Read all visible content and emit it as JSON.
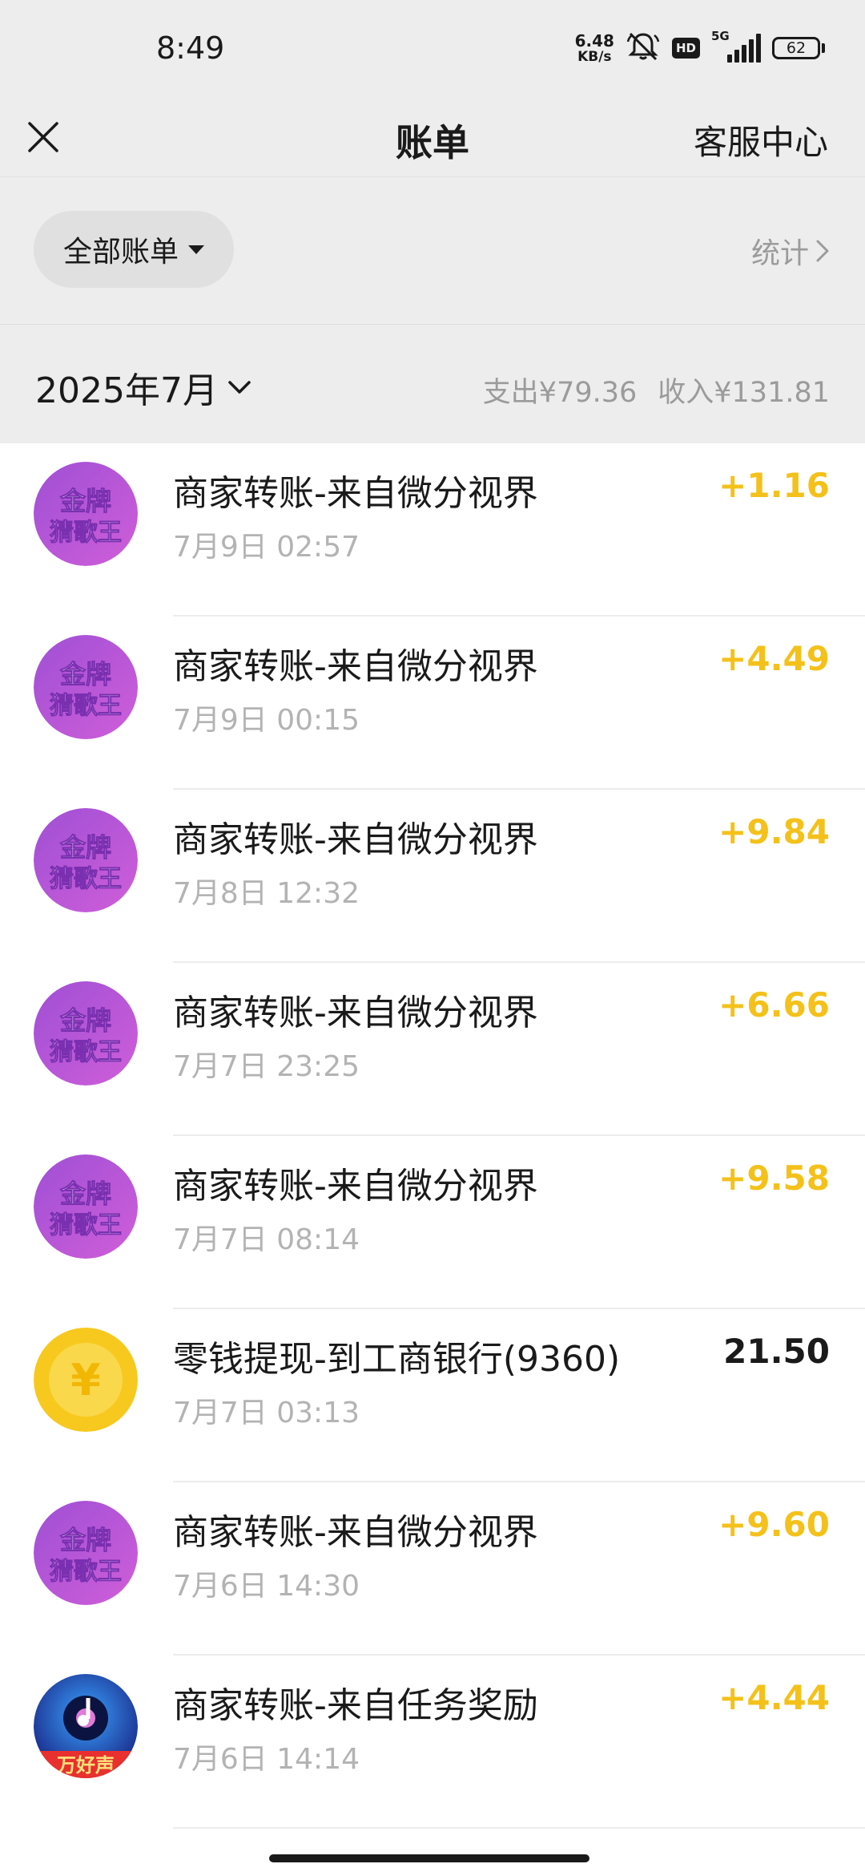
{
  "status_bar": {
    "time": "8:49",
    "net_speed_value": "6.48",
    "net_speed_unit": "KB/s",
    "hd_badge": "HD",
    "network_label": "5G",
    "battery": "62"
  },
  "nav": {
    "title": "账单",
    "service_label": "客服中心"
  },
  "filter": {
    "label": "全部账单",
    "stats_label": "统计"
  },
  "month": {
    "label": "2025年7月",
    "expense_summary": "支出¥79.36",
    "income_summary": "收入¥131.81"
  },
  "colors": {
    "income_amount": "#f4c11b",
    "expense_amount": "#1a1a1a",
    "merchant_avatar": "#b553d8",
    "coin_avatar": "#f7c91e"
  },
  "transactions": [
    {
      "avatar": "merchant-game-avatar",
      "avatar_text_1": "金牌",
      "avatar_text_2": "猜歌王",
      "title": "商家转账-来自微分视界",
      "time": "7月9日 02:57",
      "amount": "+1.16",
      "type": "income"
    },
    {
      "avatar": "merchant-game-avatar",
      "avatar_text_1": "金牌",
      "avatar_text_2": "猜歌王",
      "title": "商家转账-来自微分视界",
      "time": "7月9日 00:15",
      "amount": "+4.49",
      "type": "income"
    },
    {
      "avatar": "merchant-game-avatar",
      "avatar_text_1": "金牌",
      "avatar_text_2": "猜歌王",
      "title": "商家转账-来自微分视界",
      "time": "7月8日 12:32",
      "amount": "+9.84",
      "type": "income"
    },
    {
      "avatar": "merchant-game-avatar",
      "avatar_text_1": "金牌",
      "avatar_text_2": "猜歌王",
      "title": "商家转账-来自微分视界",
      "time": "7月7日 23:25",
      "amount": "+6.66",
      "type": "income"
    },
    {
      "avatar": "merchant-game-avatar",
      "avatar_text_1": "金牌",
      "avatar_text_2": "猜歌王",
      "title": "商家转账-来自微分视界",
      "time": "7月7日 08:14",
      "amount": "+9.58",
      "type": "income"
    },
    {
      "avatar": "yen-coin-icon",
      "avatar_text_1": "¥",
      "avatar_text_2": "",
      "title": "零钱提现-到工商银行(9360)",
      "time": "7月7日 03:13",
      "amount": "21.50",
      "type": "expense"
    },
    {
      "avatar": "merchant-game-avatar",
      "avatar_text_1": "金牌",
      "avatar_text_2": "猜歌王",
      "title": "商家转账-来自微分视界",
      "time": "7月6日 14:30",
      "amount": "+9.60",
      "type": "income"
    },
    {
      "avatar": "music-app-avatar",
      "avatar_text_1": "万好声",
      "avatar_text_2": "",
      "title": "商家转账-来自任务奖励",
      "time": "7月6日 14:14",
      "amount": "+4.44",
      "type": "income"
    }
  ]
}
